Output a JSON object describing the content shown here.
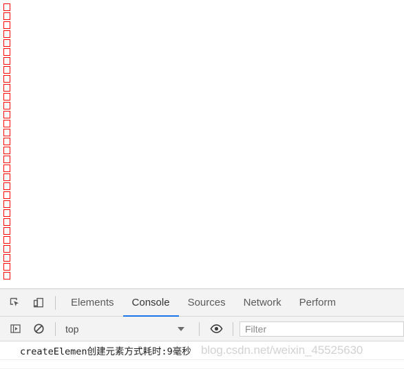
{
  "page": {
    "element_boxes": {
      "name": "created-element-boxes",
      "count": 31,
      "border_color": "#fe0000",
      "fill_color": "#ffffff"
    }
  },
  "devtools": {
    "toolbar": {
      "inspect_icon": "inspect-element-icon",
      "device_icon": "device-toolbar-icon"
    },
    "tabs": [
      {
        "label": "Elements",
        "active": false
      },
      {
        "label": "Console",
        "active": true
      },
      {
        "label": "Sources",
        "active": false
      },
      {
        "label": "Network",
        "active": false
      },
      {
        "label": "Perform",
        "active": false
      }
    ],
    "active_tab_underline_color": "#1a73e8",
    "console_toolbar": {
      "sidebar_icon": "console-sidebar-toggle-icon",
      "clear_icon": "clear-console-icon",
      "context_value": "top",
      "caret_icon": "chevron-down-icon",
      "eye_icon": "live-expression-eye-icon",
      "filter_placeholder": "Filter"
    },
    "console_output": {
      "messages": [
        {
          "text": "createElemen创建元素方式耗时:9毫秒"
        }
      ],
      "watermark": "blog.csdn.net/weixin_45525630"
    }
  }
}
